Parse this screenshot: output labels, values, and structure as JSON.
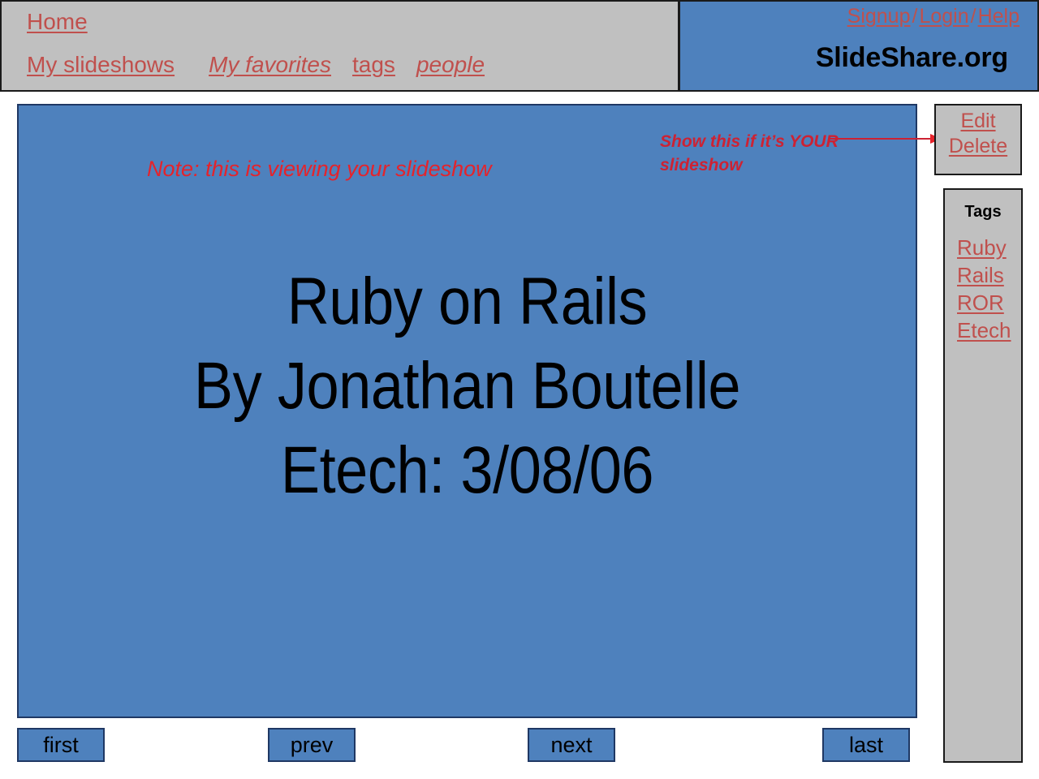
{
  "header": {
    "nav_primary": {
      "home_label": "Home"
    },
    "nav_secondary": [
      {
        "label": "My slideshows",
        "style": "normal"
      },
      {
        "label": "My favorites",
        "style": "italic"
      },
      {
        "label": "tags",
        "style": "normal"
      },
      {
        "label": "people",
        "style": "italic"
      }
    ],
    "account_links": [
      {
        "label": "Signup"
      },
      {
        "label": "Login"
      },
      {
        "label": "Help"
      }
    ],
    "account_separator": "/",
    "brand_title": "SlideShare.org"
  },
  "slide": {
    "note": "Note: this is viewing your slideshow",
    "annotation": "Show this if it’s YOUR slideshow",
    "lines": [
      "Ruby on Rails",
      "By Jonathan Boutelle",
      "Etech: 3/08/06"
    ]
  },
  "owner_actions": {
    "edit_label": "Edit",
    "delete_label": "Delete"
  },
  "tags_panel": {
    "title": "Tags",
    "tags": [
      "Ruby",
      "Rails",
      "ROR",
      "Etech"
    ]
  },
  "slide_nav": {
    "first_label": "first",
    "prev_label": "prev",
    "next_label": "next",
    "last_label": "last"
  },
  "colors": {
    "slide_blue": "#4e81bd",
    "panel_gray": "#c0c0c0",
    "link_red": "#c0504d",
    "note_red": "#e5232b",
    "annotation_red": "#cd2233",
    "border_dark": "#1a1a1a",
    "slide_border": "#1f3864"
  }
}
